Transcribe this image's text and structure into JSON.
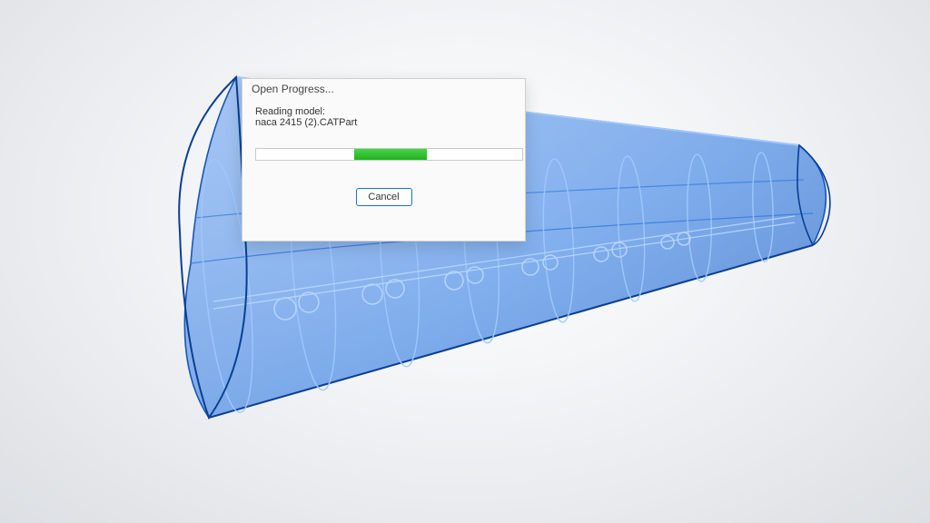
{
  "dialog": {
    "title": "Open Progress...",
    "status_label": "Reading model:",
    "filename": "naca 2415 (2).CATPart",
    "cancel_label": "Cancel",
    "progress": {
      "start_pct": 37,
      "end_pct": 64
    }
  },
  "colors": {
    "wireframe_stroke": "#1860c0",
    "wireframe_fill": "#1d6fe0",
    "progress_start": "#49d34a",
    "progress_end": "#1fb31f",
    "button_border": "#1a6fcf"
  },
  "model": {
    "name": "wing-airfoil-wireframe"
  }
}
